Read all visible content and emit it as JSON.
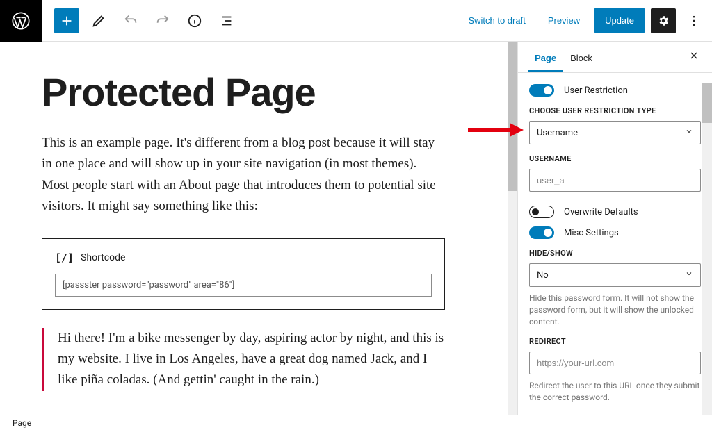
{
  "toolbar": {
    "switch_draft": "Switch to draft",
    "preview": "Preview",
    "update": "Update"
  },
  "content": {
    "title": "Protected Page",
    "intro": "This is an example page. It's different from a blog post because it will stay in one place and will show up in your site navigation (in most themes). Most people start with an About page that introduces them to potential site visitors. It might say something like this:",
    "shortcode_label": "Shortcode",
    "shortcode_value": "[passster password=\"password\" area=\"86\"]",
    "quote": "Hi there! I'm a bike messenger by day, aspiring actor by night, and this is my website. I live in Los Angeles, have a great dog named Jack, and I like piña coladas. (And gettin' caught in the rain.)"
  },
  "sidebar": {
    "tabs": {
      "page": "Page",
      "block": "Block"
    },
    "user_restriction_label": "User Restriction",
    "restriction_type_label": "CHOOSE USER RESTRICTION TYPE",
    "restriction_type_value": "Username",
    "username_label": "USERNAME",
    "username_placeholder": "user_a",
    "overwrite_label": "Overwrite Defaults",
    "misc_label": "Misc Settings",
    "hide_show_label": "HIDE/SHOW",
    "hide_show_value": "No",
    "hide_show_help": "Hide this password form. It will not show the password form, but it will show the unlocked content.",
    "redirect_label": "REDIRECT",
    "redirect_placeholder": "https://your-url.com",
    "redirect_help": "Redirect the user to this URL once they submit the correct password."
  },
  "footer": {
    "breadcrumb": "Page"
  }
}
